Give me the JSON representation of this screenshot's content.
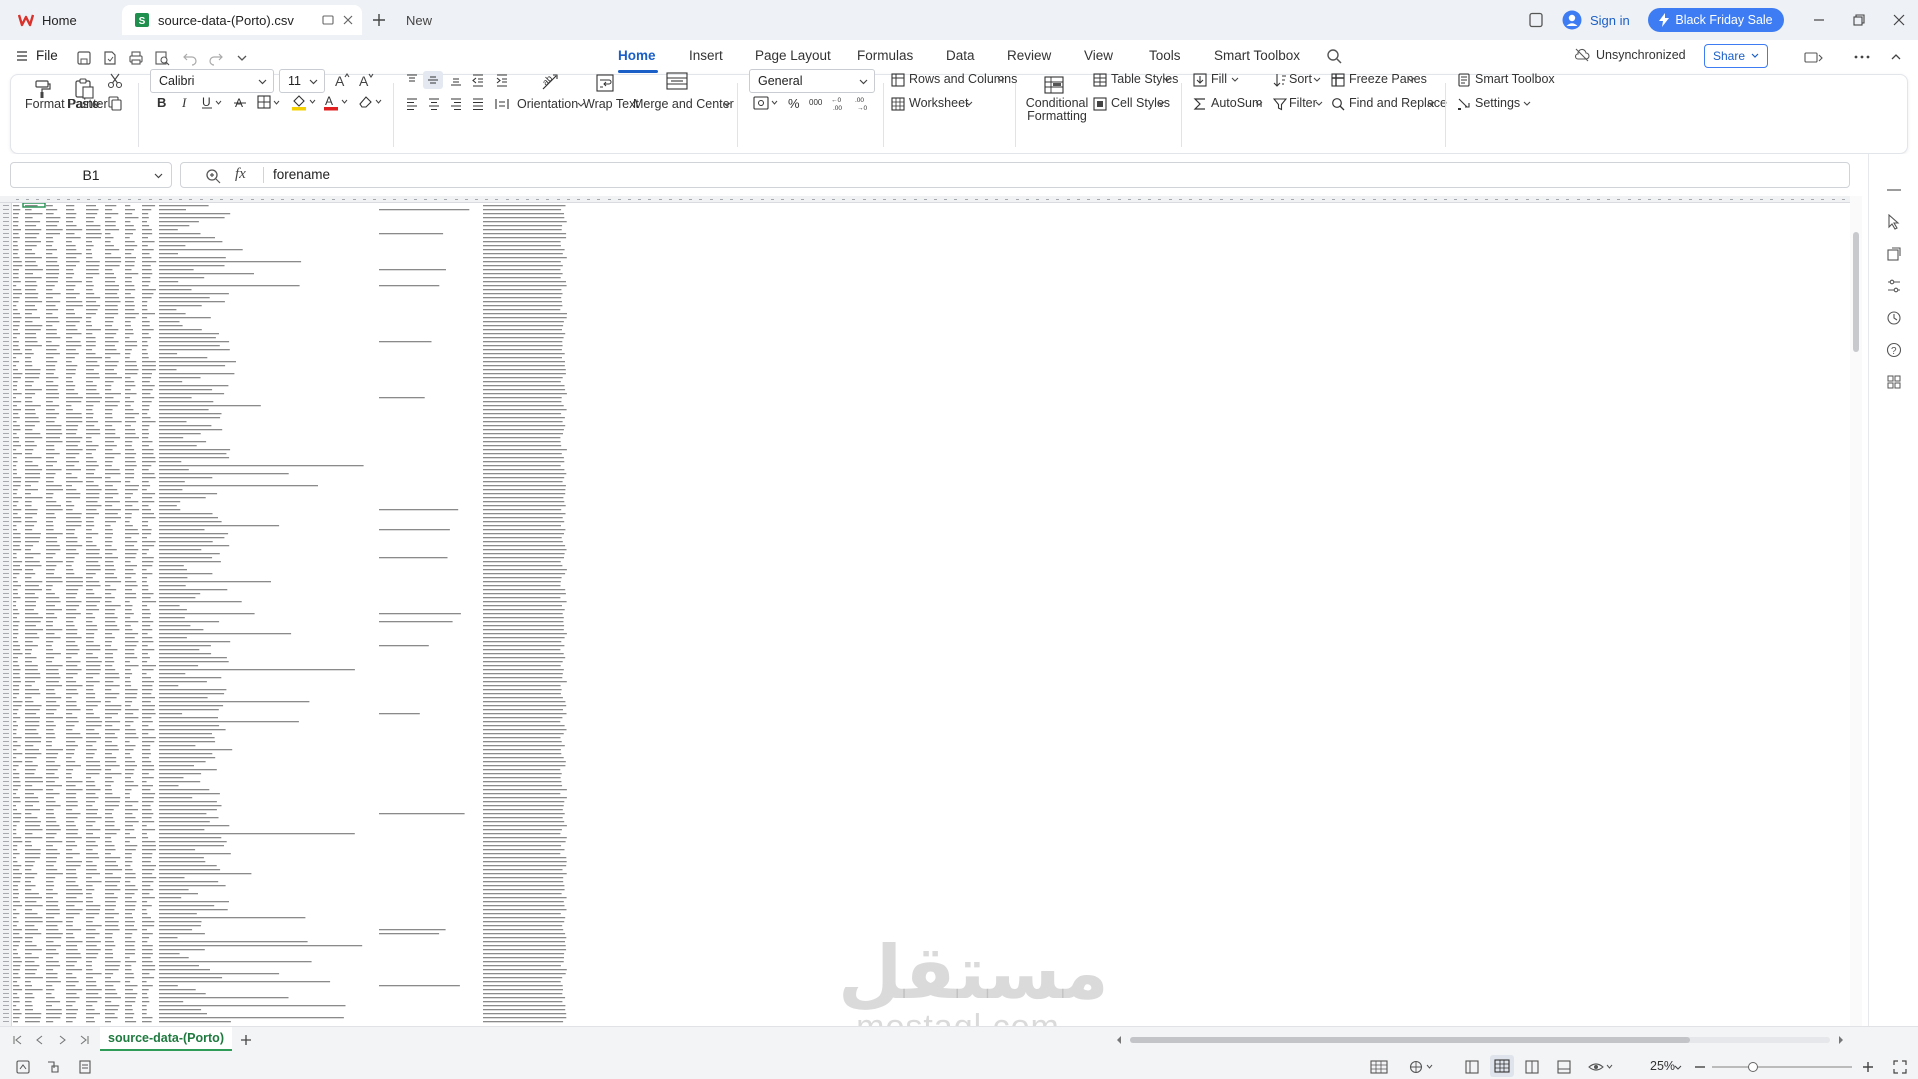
{
  "titlebar": {
    "home_tab": "Home",
    "file_tab": "source-data-(Porto).csv",
    "new_tab": "New",
    "signin": "Sign in",
    "promo": "Black Friday Sale"
  },
  "menu": {
    "file": "File",
    "tabs": [
      "Home",
      "Insert",
      "Page Layout",
      "Formulas",
      "Data",
      "Review",
      "View",
      "Tools",
      "Smart Toolbox"
    ],
    "active_tab": "Home",
    "sync_status": "Unsynchronized",
    "share": "Share"
  },
  "ribbon": {
    "format_painter": "Format Painter",
    "paste": "Paste",
    "font_name": "Calibri",
    "font_size": "11",
    "orientation": "Orientation",
    "wrap_text": "Wrap Text",
    "merge_center": "Merge and Center",
    "number_format": "General",
    "rows_columns": "Rows and  Columns",
    "worksheet": "Worksheet",
    "conditional_formatting": "Conditional Formatting",
    "table_styles": "Table Styles",
    "cell_styles": "Cell Styles",
    "fill": "Fill",
    "autosum": "AutoSum",
    "sort": "Sort",
    "filter": "Filter",
    "freeze_panes": "Freeze Panes",
    "find_replace": "Find and  Replace",
    "smart_toolbox": "Smart Toolbox",
    "settings": "Settings"
  },
  "formula_bar": {
    "cell_ref": "B1",
    "fx": "fx",
    "content": "forename"
  },
  "sheet": {
    "tab_name": "source-data-(Porto)"
  },
  "statusbar": {
    "zoom": "25%"
  },
  "watermark": {
    "arabic": "مستقل",
    "latin": "mostaql.com"
  },
  "colors": {
    "accent": "#1a5fc7",
    "promo": "#3d7cf2",
    "sheet_green": "#1f7a3f",
    "wps_red": "#d9312b"
  }
}
